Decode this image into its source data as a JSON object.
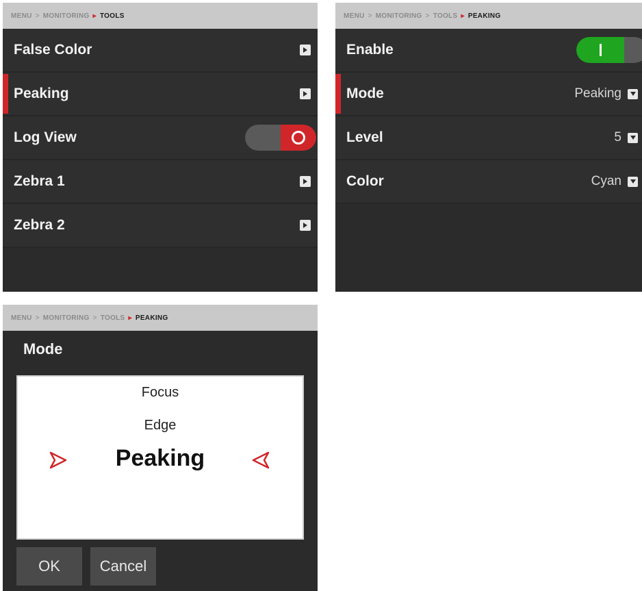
{
  "tools_panel": {
    "breadcrumb": {
      "menu": "MENU",
      "monitoring": "MONITORING",
      "current": "TOOLS"
    },
    "items": [
      {
        "label": "False Color"
      },
      {
        "label": "Peaking"
      },
      {
        "label": "Log View"
      },
      {
        "label": "Zebra 1"
      },
      {
        "label": "Zebra 2"
      }
    ]
  },
  "peaking_panel": {
    "breadcrumb": {
      "menu": "MENU",
      "monitoring": "MONITORING",
      "tools": "TOOLS",
      "current": "PEAKING"
    },
    "enable_label": "Enable",
    "mode_label": "Mode",
    "mode_value": "Peaking",
    "level_label": "Level",
    "level_value": "5",
    "color_label": "Color",
    "color_value": "Cyan"
  },
  "mode_dialog": {
    "breadcrumb": {
      "menu": "MENU",
      "monitoring": "MONITORING",
      "tools": "TOOLS",
      "current": "PEAKING"
    },
    "title": "Mode",
    "options": [
      "Focus",
      "Edge",
      "Peaking"
    ],
    "selected": "Peaking",
    "ok_label": "OK",
    "cancel_label": "Cancel"
  },
  "colors": {
    "accent_red": "#d0262a",
    "toggle_on_green": "#1fa51f",
    "panel_bg": "#2b2b2b",
    "breadcrumb_bg": "#c9c9c9"
  },
  "icons": {
    "row_chevron": "chevron-right-icon",
    "value_dropdown": "dropdown-triangle-icon",
    "picker_left": "triangle-right-outline-icon",
    "picker_right": "triangle-left-outline-icon"
  },
  "states": {
    "log_view_enabled": false,
    "peaking_enabled": true
  }
}
